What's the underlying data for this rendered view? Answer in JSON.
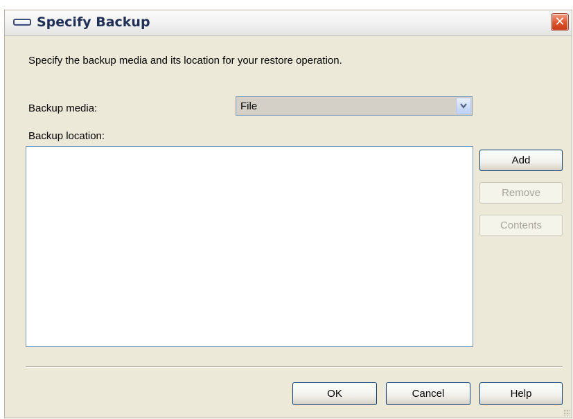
{
  "window": {
    "title": "Specify Backup",
    "close_symbol": "✕"
  },
  "instruction": "Specify the backup media and its location for your restore operation.",
  "backup_media": {
    "label": "Backup media:",
    "value": "File",
    "arrow_symbol": "⌄"
  },
  "backup_location": {
    "label": "Backup location:",
    "items": []
  },
  "side_buttons": {
    "add": "Add",
    "remove": "Remove",
    "contents": "Contents"
  },
  "footer_buttons": {
    "ok": "OK",
    "cancel": "Cancel",
    "help": "Help"
  },
  "icons": {
    "title": "window-icon",
    "close": "close-icon",
    "dropdown": "chevron-down-icon",
    "grip": "resize-grip-icon"
  },
  "colors": {
    "dialog_background": "#ece9d8",
    "close_button": "#e0522b",
    "button_border": "#003c74"
  }
}
